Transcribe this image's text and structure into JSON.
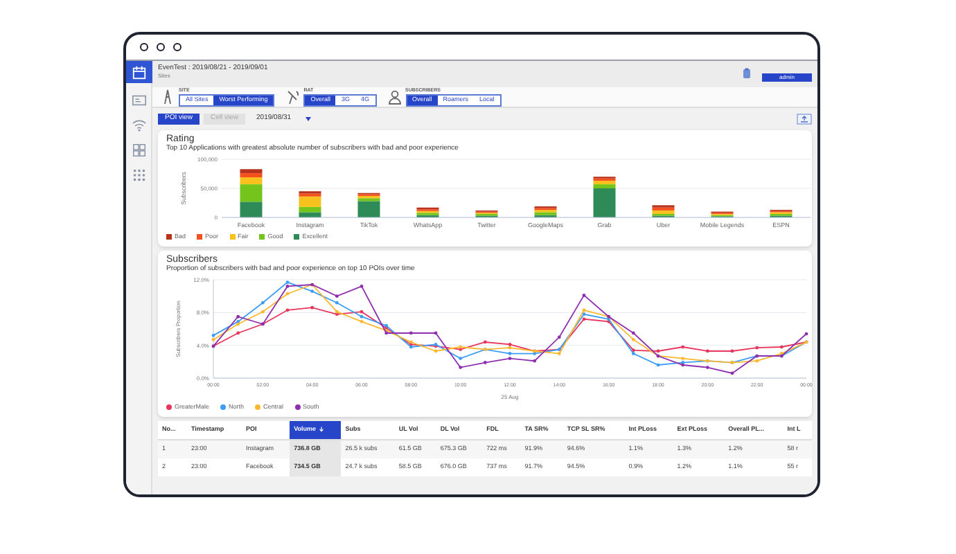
{
  "header": {
    "title": "EvenTest : 2019/08/21 - 2019/09/01",
    "subtitle": "Sites",
    "user": "admin"
  },
  "sidebar": {
    "items": [
      {
        "kind": "calendar",
        "selected": true
      },
      {
        "kind": "card",
        "selected": false
      },
      {
        "kind": "wifi",
        "selected": false
      },
      {
        "kind": "grid",
        "selected": false
      },
      {
        "kind": "apps",
        "selected": false
      }
    ]
  },
  "filters": [
    {
      "label": "SITE",
      "kind": "tower",
      "options": [
        {
          "label": "All Sites",
          "selected": false
        },
        {
          "label": "Worst Performing",
          "selected": true
        }
      ]
    },
    {
      "label": "RAT",
      "kind": "antenna",
      "options": [
        {
          "label": "Overall",
          "selected": true
        },
        {
          "label": "3G",
          "selected": false
        },
        {
          "label": "4G",
          "selected": false
        }
      ]
    },
    {
      "label": "SUBSCRIBERS",
      "kind": "people",
      "options": [
        {
          "label": "Overall",
          "selected": true
        },
        {
          "label": "Roamers",
          "selected": false
        },
        {
          "label": "Local",
          "selected": false
        }
      ]
    }
  ],
  "views": [
    {
      "label": "POI view",
      "selected": true
    },
    {
      "label": "Cell view",
      "selected": false
    }
  ],
  "date": "2019/08/31",
  "rating": {
    "title": "Rating",
    "subtitle": "Top 10 Applications with greatest absolute number of subscribers with bad and poor experience",
    "chart_data": {
      "type": "bar",
      "stacked": true,
      "ylabel": "Subscribers",
      "categories": [
        "Facebook",
        "Instagram",
        "TikTok",
        "WhatsApp",
        "Twitter",
        "GoogleMaps",
        "Grab",
        "Uber",
        "Mobile Legends",
        "ESPN"
      ],
      "ylim": [
        0,
        100000
      ],
      "yticks": [
        {
          "value": 0,
          "label": "0"
        },
        {
          "value": 50000,
          "label": "50,000"
        },
        {
          "value": 100000,
          "label": "100,000"
        }
      ],
      "series": [
        {
          "name": "Excellent",
          "color": "#2e8b57",
          "values": [
            27000,
            9000,
            28000,
            4000,
            3000,
            4000,
            50000,
            3000,
            2000,
            3000
          ]
        },
        {
          "name": "Good",
          "color": "#74c41c",
          "values": [
            30000,
            9000,
            5000,
            4000,
            3000,
            5000,
            7000,
            3000,
            2000,
            3000
          ]
        },
        {
          "name": "Fair",
          "color": "#f7c21e",
          "values": [
            12000,
            18000,
            4000,
            3000,
            2000,
            4000,
            6000,
            6000,
            2000,
            3000
          ]
        },
        {
          "name": "Poor",
          "color": "#f4511e",
          "values": [
            7000,
            5000,
            3000,
            3000,
            2000,
            3000,
            4000,
            5000,
            2000,
            2000
          ]
        },
        {
          "name": "Bad",
          "color": "#b8321c",
          "values": [
            7000,
            4000,
            2000,
            3000,
            2000,
            3000,
            3000,
            4000,
            2000,
            2000
          ]
        }
      ]
    }
  },
  "subscribers": {
    "title": "Subscribers",
    "subtitle": "Proportion of subscribers with bad and poor experience on top 10 POIs over time",
    "chart_data": {
      "type": "line",
      "ylabel": "Subscribers Proportion",
      "xlabel": "25 Aug",
      "x": [
        0,
        1,
        2,
        3,
        4,
        5,
        6,
        7,
        8,
        9,
        10,
        11,
        12,
        13,
        14,
        15,
        16,
        17,
        18,
        19,
        20,
        21,
        22,
        23,
        24
      ],
      "xlim": [
        0,
        24
      ],
      "ylim": [
        0,
        12
      ],
      "yticks": [
        {
          "value": 0,
          "label": "0.0%"
        },
        {
          "value": 4,
          "label": "4.0%"
        },
        {
          "value": 8,
          "label": "8.0%"
        },
        {
          "value": 12,
          "label": "12.0%"
        }
      ],
      "xticks": [
        {
          "value": 0,
          "label": "00:00"
        },
        {
          "value": 2,
          "label": "02:00"
        },
        {
          "value": 4,
          "label": "04:00"
        },
        {
          "value": 6,
          "label": "06:00"
        },
        {
          "value": 8,
          "label": "08:00"
        },
        {
          "value": 10,
          "label": "10:00"
        },
        {
          "value": 12,
          "label": "12:00"
        },
        {
          "value": 14,
          "label": "14:00"
        },
        {
          "value": 16,
          "label": "16:00"
        },
        {
          "value": 18,
          "label": "18:00"
        },
        {
          "value": 20,
          "label": "20:00"
        },
        {
          "value": 22,
          "label": "22:00"
        },
        {
          "value": 24,
          "label": "00:00"
        }
      ],
      "series": [
        {
          "name": "GreaterMale",
          "color": "#e8355b",
          "values": [
            3.9,
            5.5,
            6.6,
            8.3,
            8.6,
            7.8,
            8.1,
            6.1,
            4.1,
            3.9,
            3.5,
            4.4,
            4.1,
            3.3,
            3.5,
            7.2,
            6.9,
            3.4,
            3.3,
            3.8,
            3.3,
            3.3,
            3.7,
            3.8,
            4.4
          ]
        },
        {
          "name": "North",
          "color": "#3d9df5",
          "values": [
            5.2,
            6.9,
            9.2,
            11.7,
            10.6,
            9.2,
            7.5,
            6.4,
            3.8,
            4.1,
            2.4,
            3.5,
            3.0,
            3.0,
            3.5,
            7.8,
            7.2,
            3.0,
            1.6,
            1.9,
            2.1,
            1.9,
            2.7,
            2.7,
            4.4
          ]
        },
        {
          "name": "Central",
          "color": "#fbb82e",
          "values": [
            4.7,
            6.6,
            8.1,
            10.3,
            11.4,
            8.1,
            6.9,
            5.8,
            4.4,
            3.3,
            3.8,
            3.5,
            3.7,
            3.3,
            3.0,
            8.3,
            7.5,
            4.7,
            2.7,
            2.4,
            2.1,
            1.9,
            2.1,
            3.0,
            4.4
          ]
        },
        {
          "name": "South",
          "color": "#8e2fb0",
          "values": [
            3.9,
            7.5,
            6.6,
            11.2,
            11.4,
            10.0,
            11.2,
            5.5,
            5.5,
            5.5,
            1.3,
            1.9,
            2.4,
            2.1,
            5.0,
            10.1,
            7.5,
            5.5,
            2.7,
            1.6,
            1.3,
            0.6,
            2.7,
            2.7,
            5.4
          ]
        }
      ]
    }
  },
  "table": {
    "columns": [
      {
        "label": "No...",
        "selected": false
      },
      {
        "label": "Timestamp",
        "selected": false
      },
      {
        "label": "POI",
        "selected": false
      },
      {
        "label": "Volume",
        "selected": true
      },
      {
        "label": "Subs",
        "selected": false
      },
      {
        "label": "UL Vol",
        "selected": false
      },
      {
        "label": "DL Vol",
        "selected": false
      },
      {
        "label": "FDL",
        "selected": false
      },
      {
        "label": "TA SR%",
        "selected": false
      },
      {
        "label": "TCP SL SR%",
        "selected": false
      },
      {
        "label": "Int PLoss",
        "selected": false
      },
      {
        "label": "Ext PLoss",
        "selected": false
      },
      {
        "label": "Overall PL...",
        "selected": false
      },
      {
        "label": "Int L",
        "selected": false
      }
    ],
    "rows": [
      [
        "1",
        "23:00",
        "Instagram",
        "736.8 GB",
        "26.5 k subs",
        "61.5 GB",
        "675.3 GB",
        "722 ms",
        "91.9%",
        "94.6%",
        "1.1%",
        "1.3%",
        "1.2%",
        "58 r"
      ],
      [
        "2",
        "23:00",
        "Facebook",
        "734.5 GB",
        "24.7 k subs",
        "58.5 GB",
        "676.0 GB",
        "737 ms",
        "91.7%",
        "94.5%",
        "0.9%",
        "1.2%",
        "1.1%",
        "55 r"
      ]
    ]
  }
}
